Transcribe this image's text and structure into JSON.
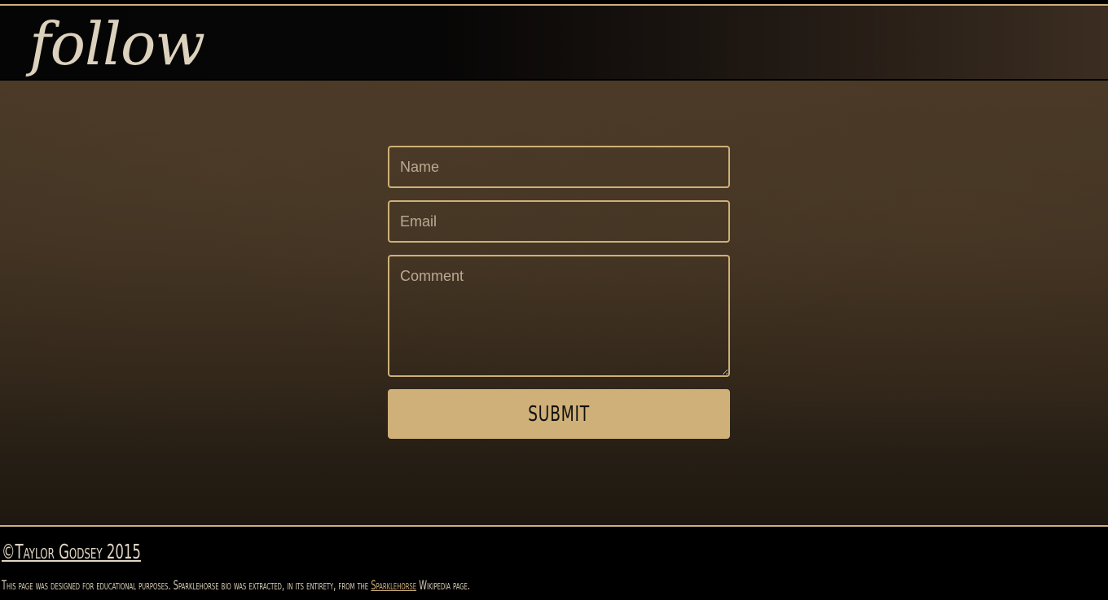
{
  "header": {
    "title": "follow"
  },
  "form": {
    "name_placeholder": "Name",
    "email_placeholder": "Email",
    "comment_placeholder": "Comment",
    "submit_label": "SUBMIT"
  },
  "footer": {
    "copyright": "©Taylor Godsey 2015",
    "note_before": "This page was designed for educational purposes. Sparklehorse bio was extracted, in its entirety, from the ",
    "note_link": "Sparklehorse",
    "note_after": " Wikipedia page."
  },
  "colors": {
    "accent": "#cfb078",
    "header_text": "#dcd1bd",
    "footer_bg": "#000000"
  }
}
